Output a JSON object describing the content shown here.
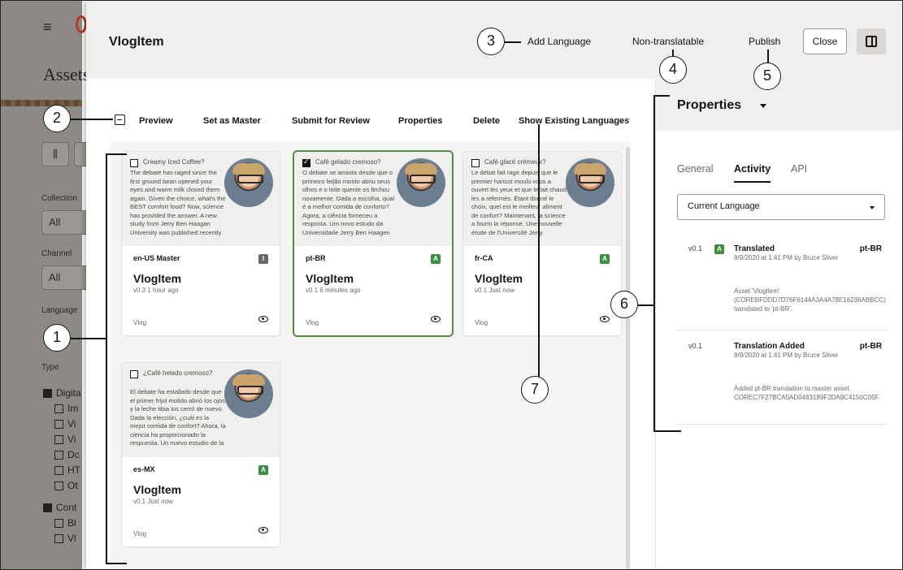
{
  "background": {
    "page_title": "Assets",
    "filters": {
      "collection_label": "Collection",
      "collection_value": "All",
      "channel_label": "Channel",
      "channel_value": "All",
      "language_label": "Language",
      "type_label": "Type",
      "type_items": [
        {
          "label": "Digita",
          "checked": true,
          "indent": false
        },
        {
          "label": "Im",
          "checked": false,
          "indent": true
        },
        {
          "label": "Vi",
          "checked": false,
          "indent": true
        },
        {
          "label": "Vi",
          "checked": false,
          "indent": true
        },
        {
          "label": "Dc",
          "checked": false,
          "indent": true
        },
        {
          "label": "HT",
          "checked": false,
          "indent": true
        },
        {
          "label": "Ot",
          "checked": false,
          "indent": true
        },
        {
          "label": "Cont",
          "checked": true,
          "indent": false
        },
        {
          "label": "Bl",
          "checked": false,
          "indent": true
        },
        {
          "label": "Vl",
          "checked": false,
          "indent": true
        }
      ]
    }
  },
  "header": {
    "title": "Vlogltem",
    "add_language": "Add Language",
    "non_translatable": "Non-translatable",
    "publish": "Publish",
    "close": "Close"
  },
  "toolbar": {
    "preview": "Preview",
    "set_as_master": "Set as Master",
    "submit_for_review": "Submit for Review",
    "properties": "Properties",
    "delete": "Delete",
    "show_existing_languages": "Show Existing Languages"
  },
  "cards": [
    {
      "question": "Creamy Iced Coffee?",
      "body": "The debate has raged since the first ground bean opened your eyes and warm milk closed them again. Given the choice, what's the BEST comfort food? Now, science has provided the answer. A new study from Jerry Ben Haagan University was published recently",
      "checked": false,
      "language": "en-US  Master",
      "badge": "I",
      "name": "Vlogltem",
      "version": "v0.3   1 hour ago",
      "type": "Vlog",
      "selected": false
    },
    {
      "question": "Café gelado cremoso?",
      "body": "O debate se arrasta desde que o primeiro feijão moído abriu seus olhos e o leite quente os fechou novamente. Dada a escolha, qual é a melhor comida de conforto? Agora, a ciência forneceu a resposta. Um novo estudo da Universidade Jerry Ben Haagen",
      "checked": true,
      "language": "pt-BR",
      "badge": "A",
      "name": "Vlogltem",
      "version": "v0.1   6 minutes ago",
      "type": "Vlog",
      "selected": true
    },
    {
      "question": "Café glacé crémeux?",
      "body": "Le débat fait rage depuis que le premier haricot moulu vous a ouvert les yeux et que le lait chaud les a refermés. Étant donné le choix, quel est le meilleur aliment de confort? Maintenant, la science a fourni la réponse. Une nouvelle étude de l'Université Jerry",
      "checked": false,
      "language": "fr-CA",
      "badge": "A",
      "name": "Vlogltem",
      "version": "v0.1   Just now",
      "type": "Vlog",
      "selected": false
    },
    {
      "question": "¿Café helado cremoso?",
      "body": "El debate ha estallado desde que el primer frijol molido abrió los ojos y la leche tibia los cerró de nuevo. Dada la elección, ¿cuál es la mejor comida de confort? Ahora, la ciencia ha proporcionado la respuesta. Un nuevo estudio de la",
      "checked": false,
      "language": "es-MX",
      "badge": "A",
      "name": "Vlogltem",
      "version": "v0.1   Just now",
      "type": "Vlog",
      "selected": false
    }
  ],
  "properties": {
    "title": "Properties",
    "tabs": [
      "General",
      "Activity",
      "API"
    ],
    "active_tab": "Activity",
    "dropdown_value": "Current Language",
    "activities": [
      {
        "version": "v0.1",
        "badge": "A",
        "title": "Translated",
        "language": "pt-BR",
        "date": "8/9/2020 at 1:41 PM by Bruce Silver",
        "detail": "Asset 'Vlogltem' (COREBFDDD7D76F6144A3A4A78E16236ABBCC) translated to 'pt-BR'."
      },
      {
        "version": "v0.1",
        "badge": "",
        "title": "Translation Added",
        "language": "pt-BR",
        "date": "8/9/2020 at 1:41 PM by Bruce Silver",
        "detail": "Added pt-BR translation to master asset COREC7F27BCA5AD0483189F2DA8C4150C05F."
      }
    ]
  },
  "callouts": [
    "1",
    "2",
    "3",
    "4",
    "5",
    "6",
    "7"
  ]
}
